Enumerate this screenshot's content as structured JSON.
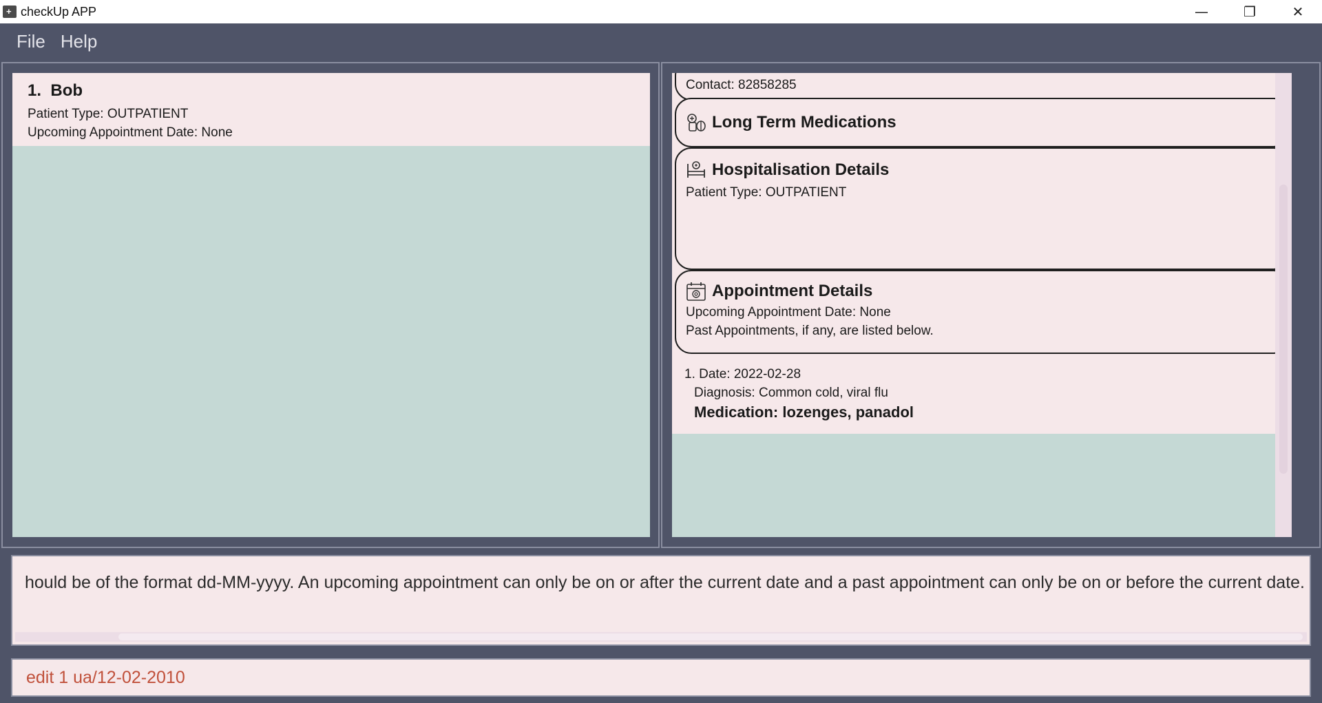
{
  "window": {
    "title": "checkUp APP",
    "controls": {
      "minimize": "—",
      "restore": "❐",
      "close": "✕"
    }
  },
  "menu": {
    "items": [
      "File",
      "Help"
    ]
  },
  "patient_list": [
    {
      "index": "1.",
      "name": "Bob",
      "patient_type": "Patient Type: OUTPATIENT",
      "upcoming": "Upcoming Appointment Date: None"
    }
  ],
  "details": {
    "contact": "Contact: 82858285",
    "medications": {
      "title": "Long Term Medications",
      "icon": "medication-icon"
    },
    "hospitalisation": {
      "title": "Hospitalisation Details",
      "icon": "hospital-bed-icon",
      "patient_type": "Patient Type: OUTPATIENT"
    },
    "appointments": {
      "title": "Appointment Details",
      "icon": "calendar-icon",
      "upcoming": "Upcoming Appointment Date: None",
      "past_note": "Past Appointments, if any, are listed below."
    },
    "past_appointments": [
      {
        "date": "1. Date: 2022-02-28",
        "diagnosis": "Diagnosis: Common cold, viral flu",
        "medication": "Medication: lozenges, panadol"
      }
    ]
  },
  "result": {
    "text": "hould be of the format dd-MM-yyyy. An upcoming appointment can only be on or after the current date and a past appointment can only be on or before the current date."
  },
  "command": {
    "value": "edit 1 ua/12-02-2010"
  },
  "colors": {
    "frame": "#4f5468",
    "card": "#f6e8ea",
    "list_bg": "#c5d9d5",
    "command_text": "#c0503a"
  }
}
